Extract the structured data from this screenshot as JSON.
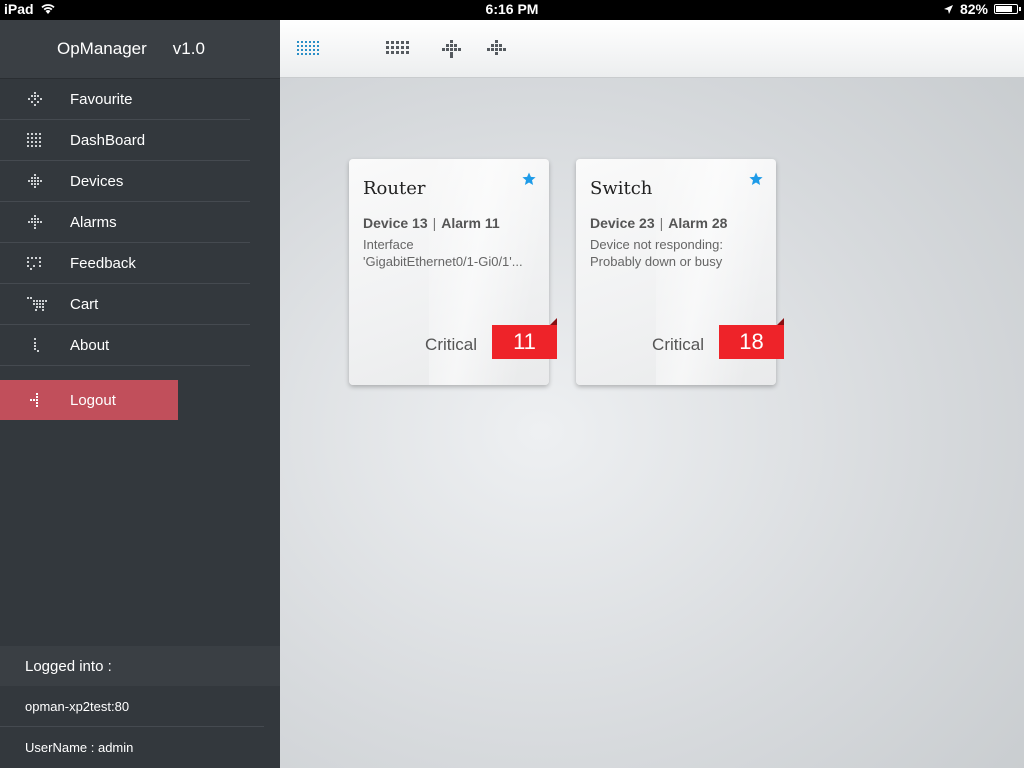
{
  "status_bar": {
    "device": "iPad",
    "time": "6:16 PM",
    "battery": "82%",
    "battery_level": 0.82
  },
  "app": {
    "title": "OpManager",
    "version": "v1.0"
  },
  "menu": {
    "items": [
      {
        "label": "Favourite",
        "icon": "favourite-icon"
      },
      {
        "label": "DashBoard",
        "icon": "dashboard-icon"
      },
      {
        "label": "Devices",
        "icon": "devices-icon"
      },
      {
        "label": "Alarms",
        "icon": "alarms-icon"
      },
      {
        "label": "Feedback",
        "icon": "feedback-icon"
      },
      {
        "label": "Cart",
        "icon": "cart-icon"
      },
      {
        "label": "About",
        "icon": "about-icon"
      }
    ],
    "logout": "Logout"
  },
  "login": {
    "heading": "Logged into :",
    "server": "opman-xp2test:80",
    "username": "UserName : admin"
  },
  "toolbar": {
    "buttons": [
      "list-view-icon",
      "grid-view-icon",
      "devices-view-icon",
      "alarms-view-icon"
    ],
    "active_color": "#2a8fc7"
  },
  "cards": [
    {
      "title": "Router",
      "device": "Device 13",
      "alarm": "Alarm 11",
      "desc_line1": "Interface",
      "desc_line2": "'GigabitEthernet0/1-Gi0/1'...",
      "severity": "Critical",
      "count": "11"
    },
    {
      "title": "Switch",
      "device": "Device 23",
      "alarm": "Alarm 28",
      "desc_line1": "Device not responding:",
      "desc_line2": "Probably down or busy",
      "severity": "Critical",
      "count": "18"
    }
  ],
  "colors": {
    "sidebar": "#33383d",
    "logout": "#c14f5b",
    "critical": "#ee2329",
    "star": "#1e9be8"
  }
}
